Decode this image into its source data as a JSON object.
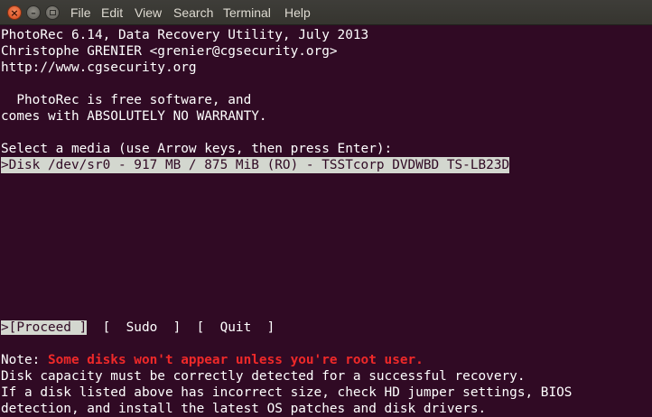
{
  "window": {
    "menu": [
      "File",
      "Edit",
      "View",
      "Search",
      "Terminal",
      "Help"
    ]
  },
  "terminal": {
    "header": [
      "PhotoRec 6.14, Data Recovery Utility, July 2013",
      "Christophe GRENIER <grenier@cgsecurity.org>",
      "http://www.cgsecurity.org"
    ],
    "license": [
      "  PhotoRec is free software, and",
      "comes with ABSOLUTELY NO WARRANTY."
    ],
    "prompt": "Select a media (use Arrow keys, then press Enter):",
    "media": [
      ">Disk /dev/sr0 - 917 MB / 875 MiB (RO) - TSSTcorp DVDWBD TS-LB23D"
    ],
    "actions": {
      "proceed": ">[Proceed ]",
      "sudo": "[  Sudo  ]",
      "quit": "[  Quit  ]"
    },
    "note": {
      "prefix": "Note: ",
      "warning": "Some disks won't appear unless you're root user.",
      "lines": [
        "Disk capacity must be correctly detected for a successful recovery.",
        "If a disk listed above has incorrect size, check HD jumper settings, BIOS",
        "detection, and install the latest OS patches and disk drivers."
      ]
    }
  },
  "colors": {
    "terminal_bg": "#300a24",
    "terminal_fg": "#ffffff",
    "selection_bg": "#d3d7cf",
    "warning": "#ef2929",
    "menubar_bg": "#3c3b37",
    "close_button": "#e95420"
  },
  "icons": {
    "close": "close-icon",
    "minimize": "minimize-icon",
    "maximize": "maximize-icon"
  }
}
